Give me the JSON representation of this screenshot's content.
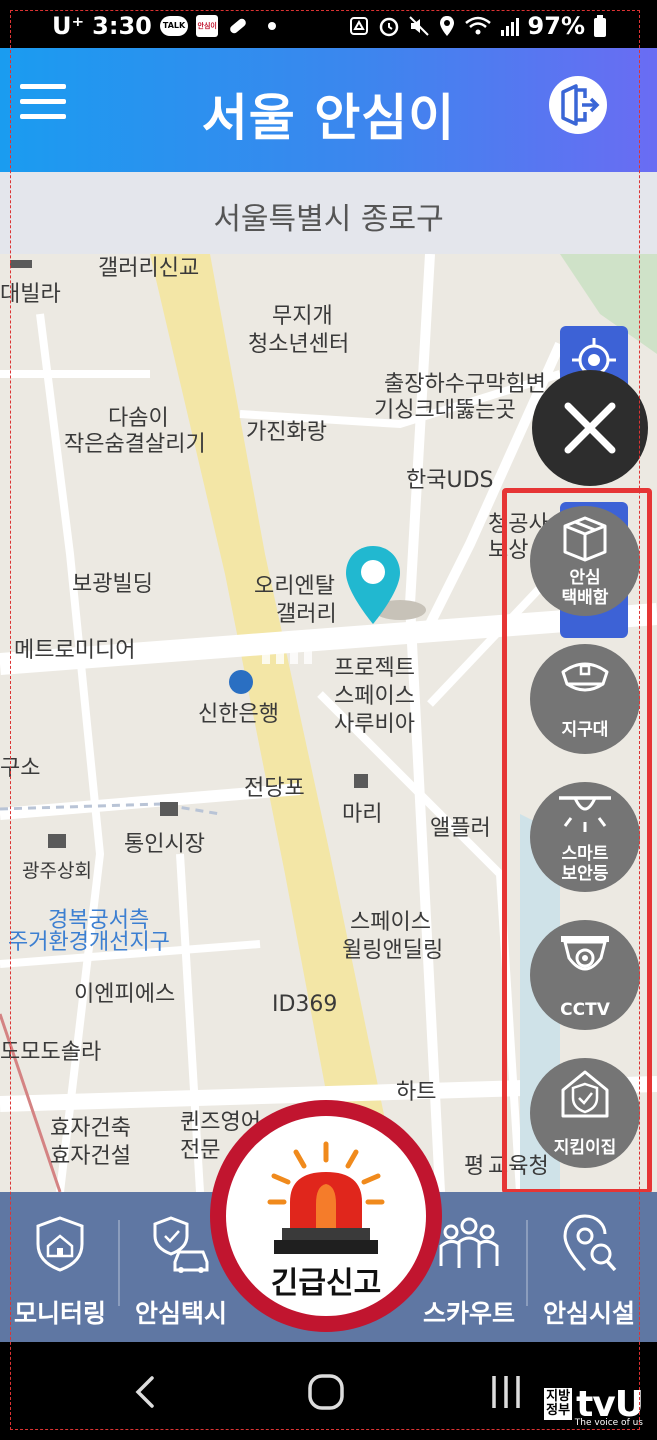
{
  "status_bar": {
    "carrier": "U⁺",
    "time": "3:30",
    "talk_badge": "TALK",
    "safe_app_badge": "안심이",
    "battery": "97%"
  },
  "header": {
    "title": "서울 안심이",
    "menu_icon": "hamburger-menu-icon",
    "logout_icon": "logout-door-icon",
    "gradient": [
      "#1a9cf0",
      "#6a6cf3"
    ]
  },
  "location": {
    "current": "서울특별시 종로구"
  },
  "map": {
    "labels": [
      "갤러리신교",
      "대빌라",
      "무지개",
      "청소년센터",
      "출장하수구막힘변",
      "기싱크대뚫는곳",
      "다솜이",
      "작은숨결살리기",
      "가진화랑",
      "한국UDS",
      "보광빌딩",
      "오리엔탈",
      "갤러리",
      "메트로미디어",
      "프로젝트",
      "스페이스",
      "사루비아",
      "신한은행",
      "구소",
      "전당포",
      "마리",
      "통인시장",
      "앨플러",
      "광주상회",
      "경복궁서측",
      "주거환경개선지구",
      "스페이스",
      "윌링앤딜링",
      "이엔피에스",
      "ID369",
      "도모도솔라",
      "하트",
      "효자건축",
      "효자건설",
      "퀸즈영어",
      "전문",
      "평",
      "교육청",
      "청공사",
      "보상"
    ]
  },
  "side_menu": {
    "close_icon": "close-x-icon",
    "locate_icon": "crosshair-locate-icon",
    "items": [
      {
        "label_line1": "안심",
        "label_line2": "택배함",
        "icon": "parcel-box-icon"
      },
      {
        "label_line1": "지구대",
        "label_line2": "",
        "icon": "police-cap-icon"
      },
      {
        "label_line1": "스마트",
        "label_line2": "보안등",
        "icon": "street-light-icon"
      },
      {
        "label_line1": "CCTV",
        "label_line2": "",
        "icon": "cctv-camera-icon"
      },
      {
        "label_line1": "지킴이집",
        "label_line2": "",
        "icon": "shield-house-icon"
      }
    ],
    "highlight_color": "#e63535"
  },
  "bottom_nav": {
    "items": [
      {
        "label": "모니터링",
        "icon": "shield-home-icon"
      },
      {
        "label": "안심택시",
        "icon": "shield-taxi-icon"
      },
      {
        "label": "스카우트",
        "icon": "group-people-icon"
      },
      {
        "label": "안심시설",
        "icon": "location-search-icon"
      }
    ],
    "emergency": {
      "label": "긴급신고",
      "icon": "siren-icon"
    }
  },
  "watermark": {
    "box_text_1": "지방",
    "box_text_2": "정부",
    "brand": "tvU",
    "tagline": "The voice of us"
  }
}
